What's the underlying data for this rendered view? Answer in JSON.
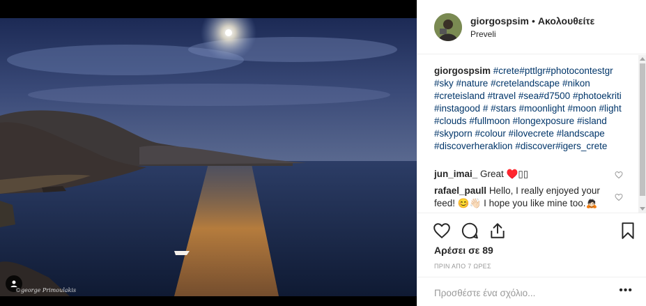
{
  "post": {
    "photo_alt": "Moon over sea at Preveli",
    "watermark": "©george Primoulakis"
  },
  "header": {
    "username": "giorgospsim",
    "separator": "•",
    "follow_label": "Ακολουθείτε",
    "location": "Preveli"
  },
  "caption": {
    "username": "giorgospsim",
    "hashtags": [
      "#crete",
      "#pttlgr",
      "#photocontestgr",
      "#sky",
      "#nature",
      "#cretelandscape",
      "#nikon",
      "#creteisland",
      "#travel",
      "#sea",
      "#d7500",
      "#photoekriti",
      "#instagood",
      "#",
      "#stars",
      "#moonlight",
      "#moon",
      "#light",
      "#clouds",
      "#fullmoon",
      "#longexposure",
      "#island",
      "#skyporn",
      "#colour",
      "#ilovecrete",
      "#landscape",
      "#discoverheraklion",
      "#discover",
      "#igers_crete"
    ]
  },
  "comments": [
    {
      "username": "jun_imai_",
      "text": "Great ♥️▯▯"
    },
    {
      "username": "rafael_paull",
      "text": "Hello, I really enjoyed your feed! 😊👋🏻 I hope you like mine too.🙇🏻"
    }
  ],
  "actions": {
    "like_icon": "heart-icon",
    "comment_icon": "comment-icon",
    "share_icon": "share-icon",
    "save_icon": "bookmark-icon"
  },
  "likes": {
    "prefix": "Αρέσει σε",
    "count": "89"
  },
  "timestamp": "ΠΡΙΝ ΑΠΟ 7 ΩΡΕΣ",
  "add_comment": {
    "placeholder": "Προσθέστε ένα σχόλιο...",
    "more_label": "•••"
  },
  "colors": {
    "hashtag": "#003569",
    "text": "#262626",
    "muted": "#999999",
    "border": "#efefef"
  }
}
